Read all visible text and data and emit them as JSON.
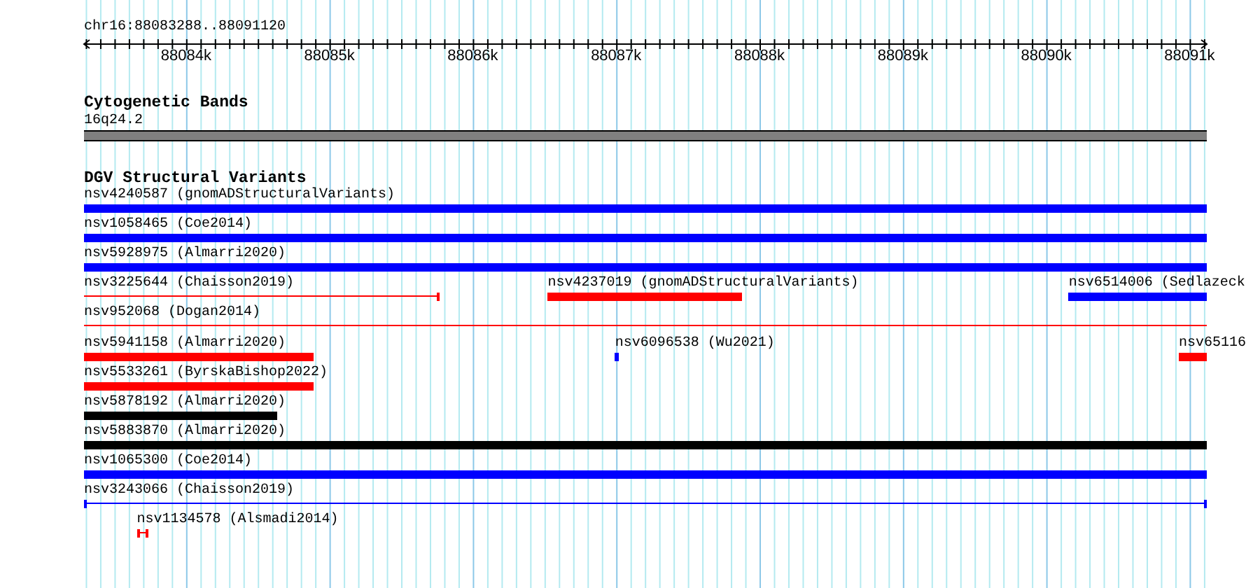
{
  "ruler": {
    "location": "chr16:88083288..88091120",
    "ticks": [
      "88084k",
      "88085k",
      "88086k",
      "88087k",
      "88088k",
      "88089k",
      "88090k",
      "88091k"
    ]
  },
  "cytogenetic_bands": {
    "title": "Cytogenetic Bands",
    "band": "16q24.2"
  },
  "dgv_track": {
    "title": "DGV Structural Variants",
    "rows": [
      {
        "features": [
          {
            "label": "nsv4240587 (gnomADStructuralVariants)",
            "kind": "bar",
            "color": "#0000ff"
          }
        ]
      },
      {
        "features": [
          {
            "label": "nsv1058465 (Coe2014)",
            "kind": "bar",
            "color": "#0000ff"
          }
        ]
      },
      {
        "features": [
          {
            "label": "nsv5928975 (Almarri2020)",
            "kind": "bar",
            "color": "#0000ff"
          }
        ]
      },
      {
        "features": [
          {
            "label": "nsv3225644 (Chaisson2019)",
            "kind": "line_end_cap",
            "color": "#ff0000"
          },
          {
            "label": "nsv4237019 (gnomADStructuralVariants)",
            "kind": "bar",
            "color": "#ff0000"
          },
          {
            "label": "nsv6514006 (Sedlazeck",
            "kind": "bar",
            "color": "#0000ff"
          }
        ]
      },
      {
        "features": [
          {
            "label": "nsv952068 (Dogan2014)",
            "kind": "line_open",
            "color": "#ff0000"
          }
        ]
      },
      {
        "features": [
          {
            "label": "nsv5941158 (Almarri2020)",
            "kind": "bar",
            "color": "#ff0000"
          },
          {
            "label": "nsv6096538 (Wu2021)",
            "kind": "bar",
            "color": "#0000ff"
          },
          {
            "label": "nsv65116",
            "kind": "bar",
            "color": "#ff0000"
          }
        ]
      },
      {
        "features": [
          {
            "label": "nsv5533261 (ByrskaBishop2022)",
            "kind": "bar",
            "color": "#ff0000"
          }
        ]
      },
      {
        "features": [
          {
            "label": "nsv5878192 (Almarri2020)",
            "kind": "bar",
            "color": "#000000"
          }
        ]
      },
      {
        "features": [
          {
            "label": "nsv5883870 (Almarri2020)",
            "kind": "bar",
            "color": "#000000"
          }
        ]
      },
      {
        "features": [
          {
            "label": "nsv1065300 (Coe2014)",
            "kind": "bar",
            "color": "#0000ff"
          }
        ]
      },
      {
        "features": [
          {
            "label": "nsv3243066 (Chaisson2019)",
            "kind": "line",
            "color": "#0000ff"
          }
        ]
      },
      {
        "features": [
          {
            "label": "nsv1134578 (Alsmadi2014)",
            "kind": "line",
            "color": "#ff0000"
          }
        ]
      }
    ]
  }
}
